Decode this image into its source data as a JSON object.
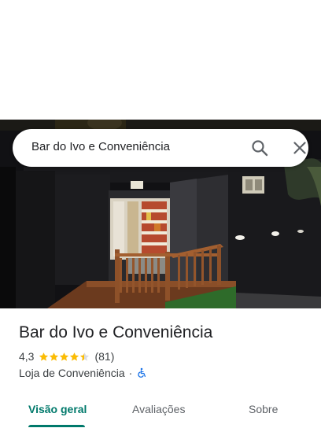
{
  "search": {
    "query": "Bar do Ivo e Conveniência",
    "search_icon": "search-icon",
    "close_icon": "close-icon"
  },
  "photo": {
    "description_icon": "storefront-photo"
  },
  "place": {
    "name": "Bar do Ivo e Conveniência",
    "rating": "4,3",
    "rating_stars": 4.3,
    "review_count": "(81)",
    "category": "Loja de Conveniência",
    "separator": "·",
    "accessibility_icon": "wheelchair-accessible-icon",
    "star_color": "#fbbc04",
    "accessibility_color": "#1a73e8"
  },
  "tabs": [
    {
      "label": "Visão geral",
      "active": true
    },
    {
      "label": "Avaliações",
      "active": false
    },
    {
      "label": "Sobre",
      "active": false
    }
  ],
  "colors": {
    "accent": "#00796b",
    "text_primary": "#202124",
    "text_secondary": "#5f6368"
  }
}
